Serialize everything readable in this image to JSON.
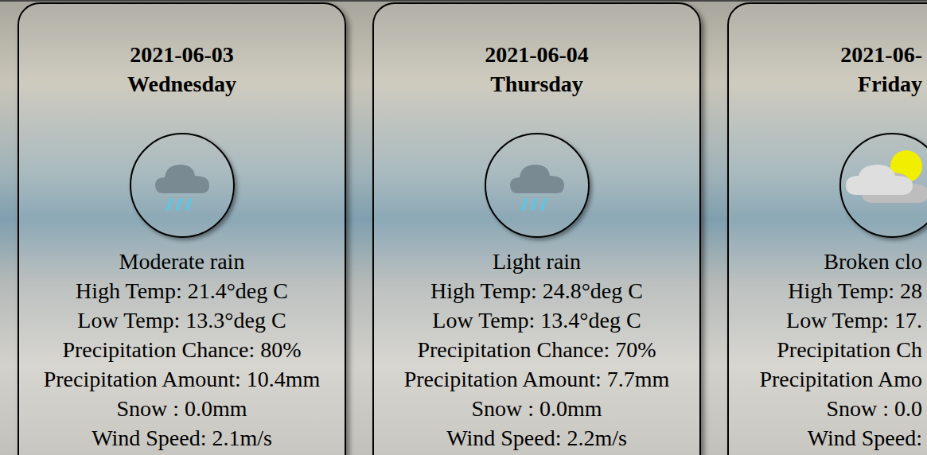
{
  "cards": [
    {
      "date": "2021-06-03",
      "day": "Wednesday",
      "kind": "rain",
      "cut_off": false,
      "details": [
        "Moderate rain",
        "High Temp: 21.4°deg C",
        "Low Temp: 13.3°deg C",
        "Precipitation Chance: 80%",
        "Precipitation Amount: 10.4mm",
        "Snow : 0.0mm",
        "Wind Speed: 2.1m/s"
      ]
    },
    {
      "date": "2021-06-04",
      "day": "Thursday",
      "kind": "rain",
      "cut_off": false,
      "details": [
        "Light rain",
        "High Temp: 24.8°deg C",
        "Low Temp: 13.4°deg C",
        "Precipitation Chance: 70%",
        "Precipitation Amount: 7.7mm",
        "Snow : 0.0mm",
        "Wind Speed: 2.2m/s"
      ]
    },
    {
      "date": "2021-06-",
      "day": "Friday",
      "kind": "clouds",
      "cut_off": true,
      "details": [
        "Broken clo",
        "High Temp: 28",
        "Low Temp: 17.",
        "Precipitation Ch",
        "Precipitation Amo",
        "Snow : 0.0",
        "Wind Speed:"
      ]
    }
  ]
}
